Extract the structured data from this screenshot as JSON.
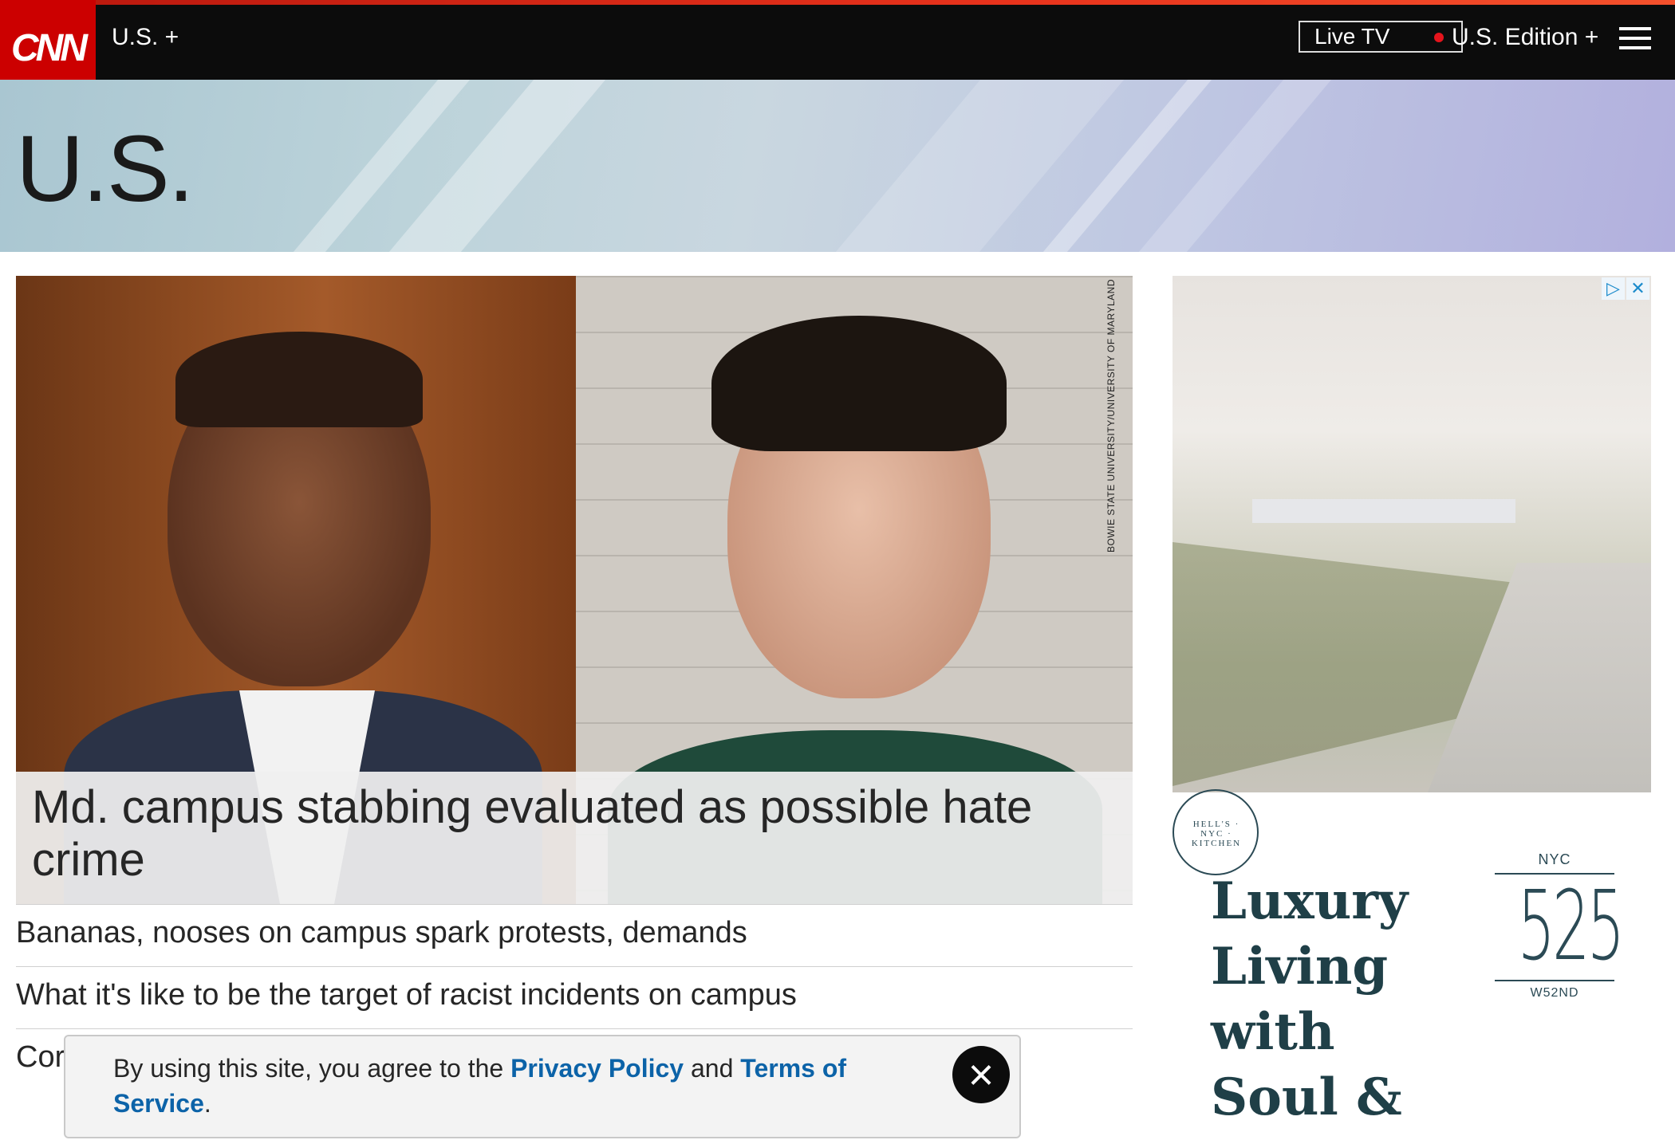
{
  "header": {
    "logo_text": "CNN",
    "section_label": "U.S. +",
    "live_tv_label": "Live TV",
    "edition_label": "U.S. Edition +",
    "menu_icon": "hamburger-icon"
  },
  "banner": {
    "title": "U.S."
  },
  "hero": {
    "headline": "Md. campus stabbing evaluated as possible hate crime",
    "photo_credit": "BOWIE STATE UNIVERSITY/UNIVERSITY OF MARYLAND"
  },
  "headlines": [
    "Bananas, nooses on campus spark protests, demands",
    "What it's like to be the target of racist incidents on campus",
    "Cor"
  ],
  "ad": {
    "seal_text": "HELL'S · NYC · KITCHEN",
    "slogan_lines": [
      "Luxury",
      "Living",
      "with",
      "Soul &"
    ],
    "brand_city": "NYC",
    "brand_number": "525",
    "brand_street": "W52ND",
    "adchoices_icon": "adchoices-icon",
    "close_icon": "close-icon"
  },
  "consent": {
    "text_before": "By using this site, you agree to the ",
    "privacy_link": "Privacy Policy",
    "text_and": " and ",
    "terms_link": "Terms of Service",
    "text_after": ".",
    "close_label": "×"
  },
  "colors": {
    "brand_red": "#cc0000",
    "link_blue": "#0c63a8",
    "top_bar": "#0c0c0c"
  }
}
